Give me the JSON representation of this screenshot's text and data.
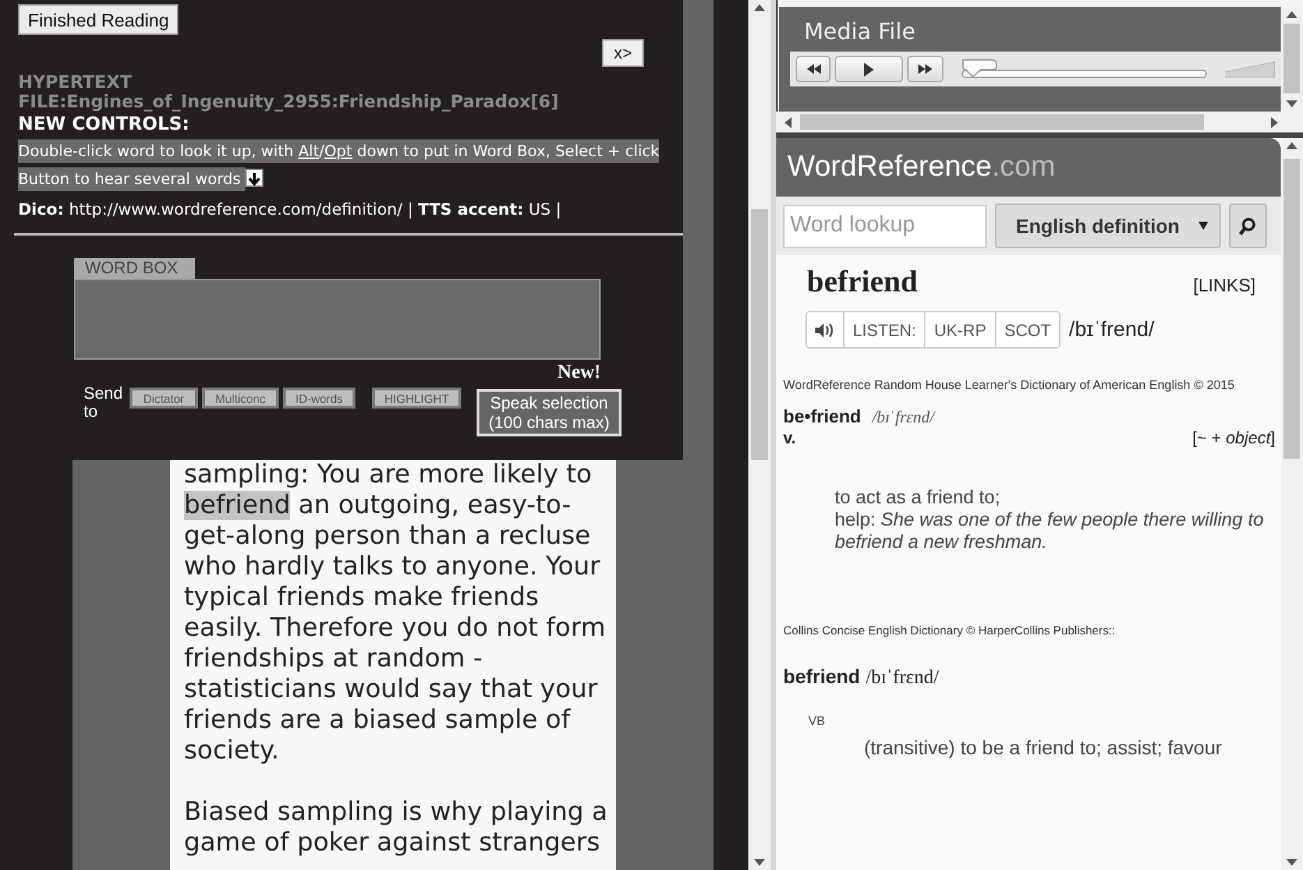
{
  "reader": {
    "finished_button": "Finished Reading",
    "close_button": "x>",
    "file_heading": "HYPERTEXT FILE:Engines_of_Ingenuity_2955:Friendship_Paradox[6]",
    "controls_heading": "NEW CONTROLS:",
    "instructions": [
      {
        "kind": "text",
        "text": "Double-click word to look it up, with "
      },
      {
        "kind": "link",
        "text": "Alt"
      },
      {
        "kind": "text",
        "text": "/"
      },
      {
        "kind": "link",
        "text": "Opt"
      },
      {
        "kind": "text",
        "text": " down to put in Word Box, Select + click Button to hear several words "
      }
    ],
    "settings_line": "**Dico:** http://www.wordreference.com/definition/ | **TTS accent:** US |",
    "word_box_label": "WORD BOX",
    "new_badge": "New!",
    "send_label": "Send to",
    "send_buttons": [
      "Dictator",
      "Multiconc",
      "ID-words"
    ],
    "highlight_button": "HIGHLIGHT",
    "speak_button": "Speak selection (100 chars max)"
  },
  "article": {
    "paragraphs": [
      [
        {
          "text": "sampling: You are more likely to ",
          "selected": false
        },
        {
          "text": "befriend",
          "selected": true
        },
        {
          "text": " an outgoing, easy-to-get-along person than a recluse who hardly talks to anyone. Your typical friends make friends easily. Therefore you do not form friendships at random - statisticians would say that your friends are a biased sample of society.",
          "selected": false
        }
      ],
      [
        {
          "text": "Biased sampling is why playing a game of poker against strangers",
          "selected": false
        }
      ]
    ]
  },
  "media": {
    "title": "Media File",
    "seek": {
      "level": 0
    },
    "volume": {
      "level": 1
    }
  },
  "dictionary": {
    "logo": "WordReference",
    "logo_suffix": ".com",
    "search": {
      "placeholder": "Word lookup"
    },
    "dropdown": "English definition",
    "headword": "befriend",
    "links": "[LINKS]",
    "listen_label": "LISTEN:",
    "accents": [
      "UK-RP",
      "SCOT"
    ],
    "pronunciation": "/bɪˈfrend/",
    "learner_entry": {
      "source": "WordReference Random House Learner's Dictionary of American English © 2015",
      "headword": "be•friend",
      "pronunciation": "/bɪˈfrɛnd/",
      "part_of_speech": "v.",
      "grammar": "[~ + *object*]",
      "definitions": [
        "to act as a friend to;",
        "help: *She was one of the few people there willing to befriend a new freshman.*"
      ]
    },
    "collins_entry": {
      "source": "Collins Concise English Dictionary © HarperCollins Publishers::",
      "headword": "befriend",
      "pronunciation": "/bɪˈfrɛnd/",
      "part_of_speech": "VB",
      "definition": "(transitive) to be a friend to; assist; favour"
    }
  }
}
